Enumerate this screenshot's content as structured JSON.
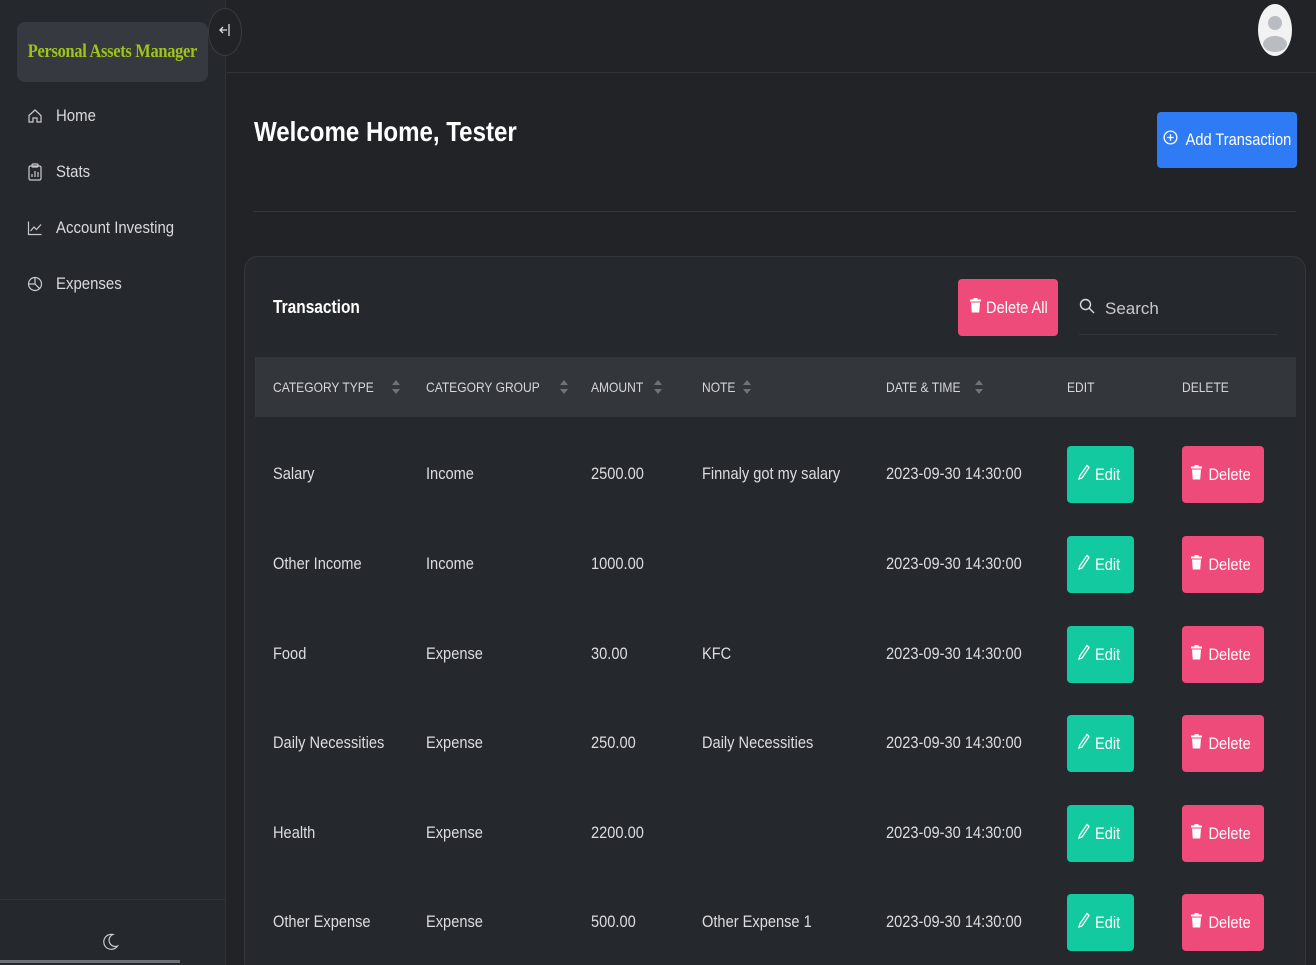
{
  "app": {
    "brand": "Personal Assets Manager"
  },
  "sidebar": {
    "items": [
      {
        "label": "Home",
        "icon": "home-icon"
      },
      {
        "label": "Stats",
        "icon": "clipboard-icon"
      },
      {
        "label": "Account Investing",
        "icon": "chart-line-icon"
      },
      {
        "label": "Expenses",
        "icon": "pie-chart-icon"
      }
    ],
    "theme_toggle_icon": "moon-icon"
  },
  "header": {
    "avatar_icon": "user-avatar-icon"
  },
  "main": {
    "welcome": "Welcome Home, Tester",
    "add_button": "Add Transaction",
    "card_title": "Transaction",
    "delete_all_button": "Delete All",
    "search": {
      "placeholder": "Search",
      "value": ""
    }
  },
  "table": {
    "columns": [
      "CATEGORY TYPE",
      "CATEGORY GROUP",
      "AMOUNT",
      "NOTE",
      "DATE & TIME",
      "EDIT",
      "DELETE"
    ],
    "edit_label": "Edit",
    "delete_label": "Delete",
    "rows": [
      {
        "type": "Salary",
        "group": "Income",
        "amount": "2500.00",
        "note": "Finnaly got my salary",
        "datetime": "2023-09-30 14:30:00"
      },
      {
        "type": "Other Income",
        "group": "Income",
        "amount": "1000.00",
        "note": "",
        "datetime": "2023-09-30 14:30:00"
      },
      {
        "type": "Food",
        "group": "Expense",
        "amount": "30.00",
        "note": "KFC",
        "datetime": "2023-09-30 14:30:00"
      },
      {
        "type": "Daily Necessities",
        "group": "Expense",
        "amount": "250.00",
        "note": "Daily Necessities",
        "datetime": "2023-09-30 14:30:00"
      },
      {
        "type": "Health",
        "group": "Expense",
        "amount": "2200.00",
        "note": "",
        "datetime": "2023-09-30 14:30:00"
      },
      {
        "type": "Other Expense",
        "group": "Expense",
        "amount": "500.00",
        "note": "Other Expense 1",
        "datetime": "2023-09-30 14:30:00"
      }
    ]
  },
  "colors": {
    "brand_text": "#9fc31a",
    "primary": "#2f7bf5",
    "danger": "#ee4a7a",
    "success": "#12c9a0",
    "background": "#212327"
  }
}
